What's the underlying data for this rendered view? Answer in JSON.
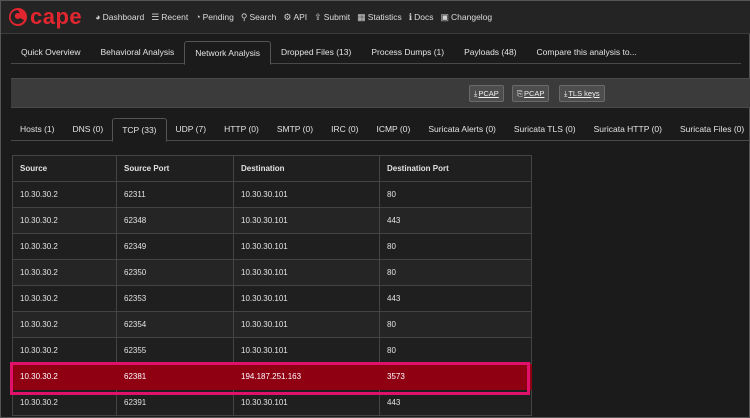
{
  "brand": {
    "name": "cape",
    "logo_icon": "cape-logo-icon"
  },
  "nav": [
    {
      "label": "Dashboard",
      "icon": "dashboard-icon",
      "glyph": "◕"
    },
    {
      "label": "Recent",
      "icon": "list-icon",
      "glyph": "☰"
    },
    {
      "label": "Pending",
      "icon": "clock-icon",
      "glyph": "◔"
    },
    {
      "label": "Search",
      "icon": "search-icon",
      "glyph": "⚲"
    },
    {
      "label": "API",
      "icon": "gear-icon",
      "glyph": "⚙"
    },
    {
      "label": "Submit",
      "icon": "upload-icon",
      "glyph": "⇪"
    },
    {
      "label": "Statistics",
      "icon": "chart-icon",
      "glyph": "▦"
    },
    {
      "label": "Docs",
      "icon": "info-icon",
      "glyph": "ℹ"
    },
    {
      "label": "Changelog",
      "icon": "changelog-icon",
      "glyph": "▣"
    }
  ],
  "analysis_tabs": [
    "Quick Overview",
    "Behavioral Analysis",
    "Network Analysis",
    "Dropped Files (13)",
    "Process Dumps (1)",
    "Payloads (48)",
    "Compare this analysis to..."
  ],
  "analysis_tab_active": "Network Analysis",
  "toolbar": {
    "pcap1": "PCAP",
    "pcap2": "PCAP",
    "tls": "TLS keys"
  },
  "network_tabs": [
    "Hosts (1)",
    "DNS (0)",
    "TCP (33)",
    "UDP (7)",
    "HTTP (0)",
    "SMTP (0)",
    "IRC (0)",
    "ICMP (0)",
    "Suricata Alerts (0)",
    "Suricata TLS (0)",
    "Suricata HTTP (0)",
    "Suricata Files (0)"
  ],
  "network_tab_active": "TCP (33)",
  "table": {
    "headers": [
      "Source",
      "Source Port",
      "Destination",
      "Destination Port"
    ],
    "rows": [
      [
        "10.30.30.2",
        "62311",
        "10.30.30.101",
        "80"
      ],
      [
        "10.30.30.2",
        "62348",
        "10.30.30.101",
        "443"
      ],
      [
        "10.30.30.2",
        "62349",
        "10.30.30.101",
        "80"
      ],
      [
        "10.30.30.2",
        "62350",
        "10.30.30.101",
        "80"
      ],
      [
        "10.30.30.2",
        "62353",
        "10.30.30.101",
        "443"
      ],
      [
        "10.30.30.2",
        "62354",
        "10.30.30.101",
        "80"
      ],
      [
        "10.30.30.2",
        "62355",
        "10.30.30.101",
        "80"
      ],
      [
        "10.30.30.2",
        "62381",
        "194.187.251.163",
        "3573"
      ],
      [
        "10.30.30.2",
        "62391",
        "10.30.30.101",
        "443"
      ]
    ],
    "highlighted_row": 7
  },
  "colors": {
    "brand_red": "#e1262f",
    "highlight_fill": "#8f0012",
    "highlight_border": "#e0116a"
  }
}
